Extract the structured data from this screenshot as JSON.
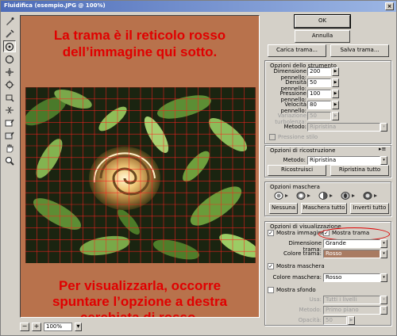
{
  "window": {
    "title": "Fluidifica (esempio.JPG @ 100%)",
    "close": "×"
  },
  "tools": [
    "warp-icon",
    "reconstruct-icon",
    "twirl-clockwise-icon",
    "twirl-counter-icon",
    "pucker-icon",
    "bloat-icon",
    "shift-pixels-icon",
    "reflection-icon",
    "freeze-icon",
    "thaw-icon",
    "hand-icon",
    "zoom-icon"
  ],
  "overlay": {
    "top_lines": [
      "La trama è il reticolo rosso",
      "dell’immagine qui sotto."
    ],
    "bottom_lines": [
      "Per visualizzarla, occorre",
      "spuntare l’opzione a destra",
      "cerchiata di rosso."
    ]
  },
  "status": {
    "minus": "−",
    "plus": "+",
    "zoom": "100%"
  },
  "buttons": {
    "ok": "OK",
    "cancel": "Annulla",
    "load_mesh": "Carica trama...",
    "save_mesh": "Salva trama..."
  },
  "tool_options": {
    "title": "Opzioni dello strumento",
    "brush_size_label": "Dimensione pennello:",
    "brush_size": "200",
    "brush_density_label": "Densità pennello:",
    "brush_density": "50",
    "brush_pressure_label": "Pressione pennello:",
    "brush_pressure": "100",
    "brush_rate_label": "Velocità pennello:",
    "brush_rate": "80",
    "turbulence_label": "Variazione turbolenza:",
    "turbulence": "50",
    "mode_label": "Metodo:",
    "mode": "Ripristina",
    "stylus_label": "Pressione stilo"
  },
  "reconstruct": {
    "title": "Opzioni di ricostruzione",
    "mode_label": "Metodo:",
    "mode": "Ripristina",
    "reconstruct_btn": "Ricostruisci",
    "restore_all_btn": "Ripristina tutto"
  },
  "mask": {
    "title": "Opzioni maschera",
    "none_btn": "Nessuna",
    "mask_all_btn": "Maschera tutto",
    "invert_all_btn": "Inverti tutto"
  },
  "view": {
    "title": "Opzioni di visualizzazione",
    "show_image": "Mostra immagine",
    "show_mesh": "Mostra trama",
    "mesh_size_label": "Dimensione trama:",
    "mesh_size": "Grande",
    "mesh_color_label": "Colore trama:",
    "mesh_color": "Rosso",
    "show_mask": "Mostra maschera",
    "mask_color_label": "Colore maschera:",
    "mask_color": "Rosso",
    "show_backdrop": "Mostra sfondo",
    "use_label": "Usa:",
    "use": "Tutti i livelli",
    "bg_mode_label": "Metodo:",
    "bg_mode": "Primo piano",
    "opacity_label": "Opacità:",
    "opacity": "50"
  },
  "colors": {
    "overlay_text": "#e00000",
    "canvas_bg": "#b8724c",
    "mesh_color_swatch": "#a97b62",
    "mesh": "#ff2020"
  }
}
